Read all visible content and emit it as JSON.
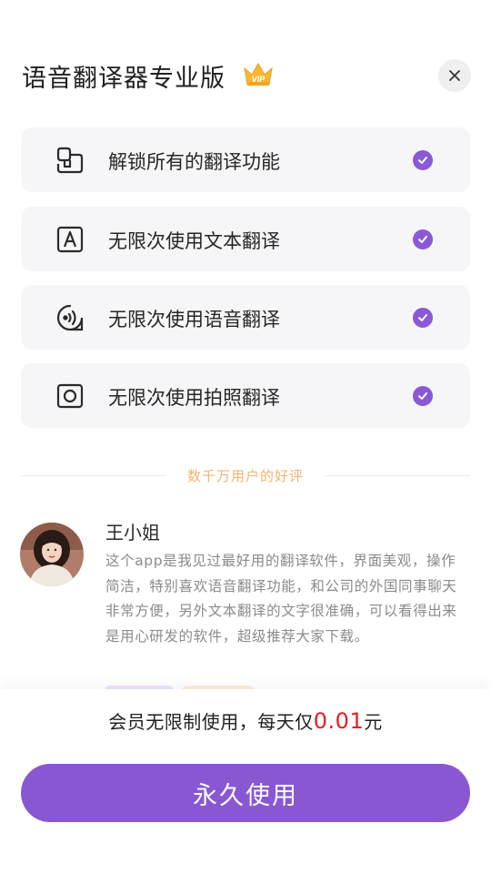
{
  "header": {
    "title": "语音翻译器专业版",
    "badge_icon": "vip-crown-icon",
    "close_icon": "close-icon"
  },
  "features": [
    {
      "label": "解锁所有的翻译功能",
      "icon": "unlock-features-icon",
      "checked": true
    },
    {
      "label": "无限次使用文本翻译",
      "icon": "text-translate-icon",
      "checked": true
    },
    {
      "label": "无限次使用语音翻译",
      "icon": "voice-translate-icon",
      "checked": true
    },
    {
      "label": "无限次使用拍照翻译",
      "icon": "camera-translate-icon",
      "checked": true
    }
  ],
  "reviews_heading": "数千万用户的好评",
  "review": {
    "name": "王小姐",
    "text": "这个app是我见过最好用的翻译软件，界面美观，操作简洁，特别喜欢语音翻译功能，和公司的外国同事聊天非常方便，另外文本翻译的文字很准确，可以看得出来是用心研发的软件，超级推荐大家下载。"
  },
  "purchase": {
    "prefix": "会员无限制使用，每天仅",
    "price": "0.01",
    "suffix": "元",
    "cta_label": "永久使用"
  },
  "colors": {
    "accent": "#8a57d3",
    "price": "#e61e1e",
    "heading_orange": "#f0b470",
    "card_bg": "#f6f6f8"
  }
}
